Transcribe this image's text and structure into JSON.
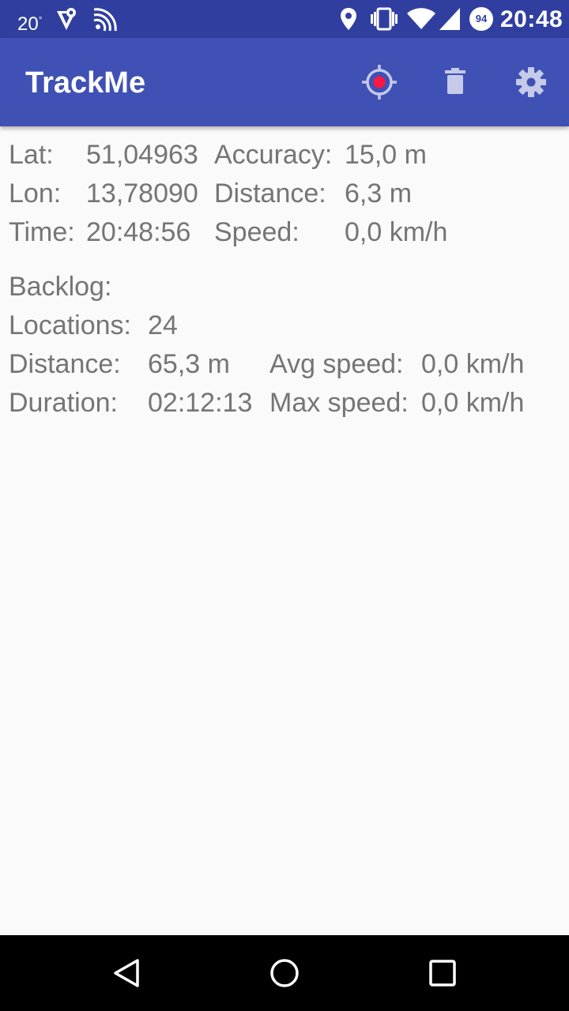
{
  "status_bar": {
    "temperature": "20",
    "degree": "°",
    "battery_level": "94",
    "time": "20:48",
    "icons": [
      "maps-navigation-icon",
      "nfc-signal-icon",
      "location-pin-icon",
      "vibrate-icon",
      "wifi-icon",
      "cell-signal-icon",
      "battery-icon"
    ]
  },
  "app_bar": {
    "title": "TrackMe",
    "actions": [
      "gps-fix-icon",
      "delete-icon",
      "settings-icon"
    ],
    "accent_color": "#3f51b5",
    "record_dot_color": "#ff1744"
  },
  "current": {
    "lat_label": "Lat:",
    "lat_value": "51,04963",
    "lon_label": "Lon:",
    "lon_value": "13,78090",
    "time_label": "Time:",
    "time_value": "20:48:56",
    "accuracy_label": "Accuracy:",
    "accuracy_value": "15,0 m",
    "distance_label": "Distance:",
    "distance_value": "6,3 m",
    "speed_label": "Speed:",
    "speed_value": "0,0 km/h"
  },
  "backlog": {
    "heading": "Backlog:",
    "locations_label": "Locations:",
    "locations_value": "24",
    "distance_label": "Distance:",
    "distance_value": "65,3 m",
    "duration_label": "Duration:",
    "duration_value": "02:12:13",
    "avg_speed_label": "Avg speed:",
    "avg_speed_value": "0,0 km/h",
    "max_speed_label": "Max speed:",
    "max_speed_value": "0,0 km/h"
  },
  "nav_bar": {
    "buttons": [
      "back-icon",
      "home-icon",
      "recents-icon"
    ]
  }
}
